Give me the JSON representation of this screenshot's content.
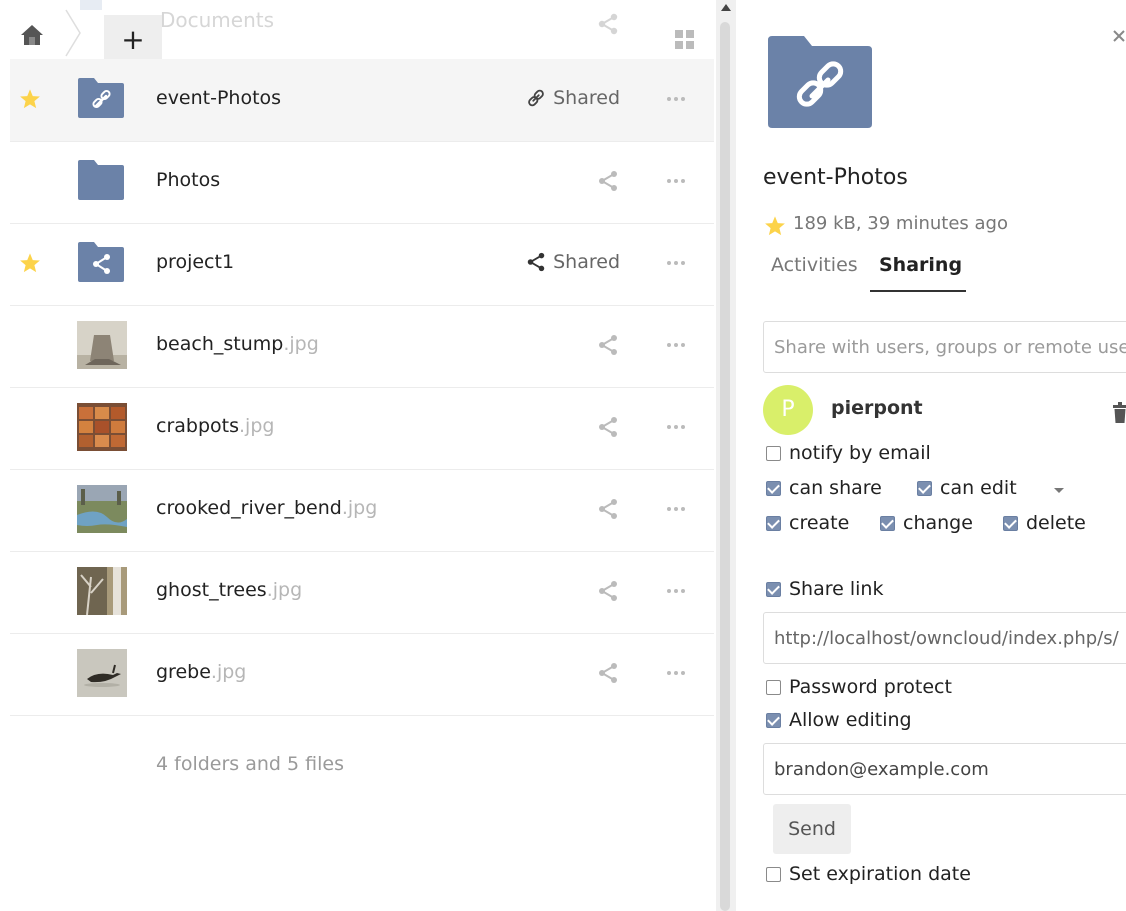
{
  "breadcrumb": {
    "current": "Documents",
    "new_label": "+"
  },
  "files": [
    {
      "name": "event-Photos",
      "ext": "",
      "type": "folder-link",
      "favorite": true,
      "share_label": "Shared",
      "selected": true
    },
    {
      "name": "Photos",
      "ext": "",
      "type": "folder",
      "favorite": false,
      "share_label": ""
    },
    {
      "name": "project1",
      "ext": "",
      "type": "folder-shared",
      "favorite": true,
      "share_label": "Shared"
    },
    {
      "name": "beach_stump",
      "ext": ".jpg",
      "type": "image",
      "favorite": false,
      "share_label": ""
    },
    {
      "name": "crabpots",
      "ext": ".jpg",
      "type": "image",
      "favorite": false,
      "share_label": ""
    },
    {
      "name": "crooked_river_bend",
      "ext": ".jpg",
      "type": "image",
      "favorite": false,
      "share_label": ""
    },
    {
      "name": "ghost_trees",
      "ext": ".jpg",
      "type": "image",
      "favorite": false,
      "share_label": ""
    },
    {
      "name": "grebe",
      "ext": ".jpg",
      "type": "image",
      "favorite": false,
      "share_label": ""
    }
  ],
  "summary": "4 folders and 5 files",
  "sidebar": {
    "title": "event-Photos",
    "meta": "189 kB, 39 minutes ago",
    "tabs": {
      "activities": "Activities",
      "sharing": "Sharing"
    },
    "share_placeholder": "Share with users, groups or remote users…",
    "recipient": {
      "initial": "P",
      "name": "pierpont",
      "notify_label": "notify by email",
      "can_share_label": "can share",
      "can_edit_label": "can edit",
      "create_label": "create",
      "change_label": "change",
      "delete_label": "delete"
    },
    "share_link_label": "Share link",
    "link_url": "http://localhost/owncloud/index.php/s/",
    "password_label": "Password protect",
    "allow_editing_label": "Allow editing",
    "email_value": "brandon@example.com",
    "send_label": "Send",
    "expiration_label": "Set expiration date"
  },
  "colors": {
    "folder": "#6b82a8",
    "star": "#fcd34a",
    "accent": "#7b8fb0",
    "avatar": "#d9ef6a"
  },
  "icons": [
    "home-icon",
    "star-icon",
    "folder-icon",
    "link-icon",
    "share-icon",
    "more-icon",
    "view-toggle-icon",
    "close-icon",
    "trash-icon",
    "caret-icon"
  ]
}
